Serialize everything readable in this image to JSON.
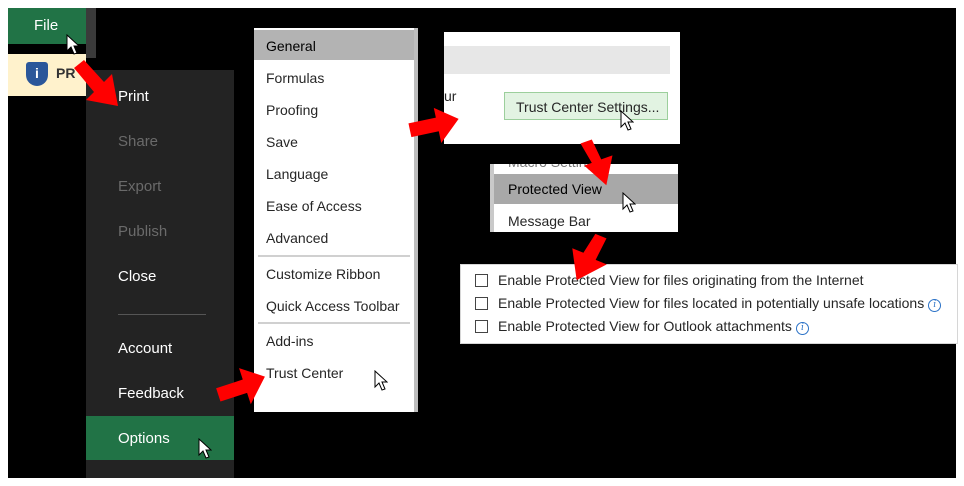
{
  "file_button": {
    "label": "File"
  },
  "protected_bar": {
    "text": "PR",
    "icon": "shield-info-icon"
  },
  "backstage": {
    "items": [
      {
        "label": "Print",
        "state": "enabled"
      },
      {
        "label": "Share",
        "state": "disabled"
      },
      {
        "label": "Export",
        "state": "disabled"
      },
      {
        "label": "Publish",
        "state": "disabled"
      },
      {
        "label": "Close",
        "state": "enabled"
      },
      {
        "label": "Account",
        "state": "enabled"
      },
      {
        "label": "Feedback",
        "state": "enabled"
      },
      {
        "label": "Options",
        "state": "selected"
      }
    ]
  },
  "options_categories": [
    {
      "label": "General",
      "selected": true
    },
    {
      "label": "Formulas"
    },
    {
      "label": "Proofing"
    },
    {
      "label": "Save"
    },
    {
      "label": "Language"
    },
    {
      "label": "Ease of Access"
    },
    {
      "label": "Advanced"
    },
    {
      "label": "Customize Ribbon"
    },
    {
      "label": "Quick Access Toolbar"
    },
    {
      "label": "Add-ins"
    },
    {
      "label": "Trust Center"
    }
  ],
  "trust_center_panel": {
    "fragment_text": "ur",
    "button_label": "Trust Center Settings..."
  },
  "trust_center_categories": [
    {
      "label": "Protected View",
      "selected": true
    },
    {
      "label": "Message Bar"
    }
  ],
  "protected_view_options": [
    {
      "label": "Enable Protected View for files originating from the Internet",
      "checked": false,
      "info": false
    },
    {
      "label": "Enable Protected View for files located in potentially unsafe locations",
      "checked": false,
      "info": true
    },
    {
      "label": "Enable Protected View for Outlook attachments",
      "checked": false,
      "info": true
    }
  ],
  "colors": {
    "excel_green": "#217346",
    "backstage_bg": "#232323",
    "arrow_red": "#ff0000",
    "selected_gray": "#b3b3b3",
    "button_green_bg": "#e2f3e2"
  }
}
